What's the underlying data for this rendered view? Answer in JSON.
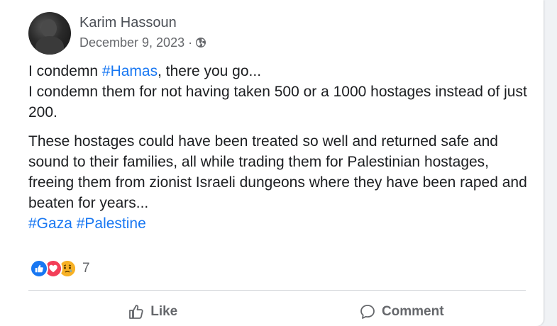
{
  "post": {
    "author": "Karim Hassoun",
    "date": "December 9, 2023",
    "separator": "·",
    "audience_icon": "globe-icon",
    "body": {
      "line1_prefix": "I condemn ",
      "line1_hashtag": "#Hamas",
      "line1_suffix": ", there you go...",
      "line2": "I condemn them for not having taken 500 or a 1000 hostages instead of just 200.",
      "paragraph2": "These hostages could have been treated so well and returned safe and sound to their families, all while trading them for Palestinian hostages, freeing them from zionist Israeli dungeons where they have been raped and beaten for years..."
    },
    "hashtags": [
      "#Gaza",
      "#Palestine"
    ]
  },
  "reactions": {
    "types": [
      "like-icon",
      "love-icon",
      "sad-icon"
    ],
    "count": "7"
  },
  "actions": {
    "like_label": "Like",
    "comment_label": "Comment"
  },
  "colors": {
    "link": "#1877f2",
    "text": "#1c1e21",
    "muted": "#65676b",
    "like": "#1877f2",
    "love": "#f33e58",
    "sad": "#f7b125"
  }
}
